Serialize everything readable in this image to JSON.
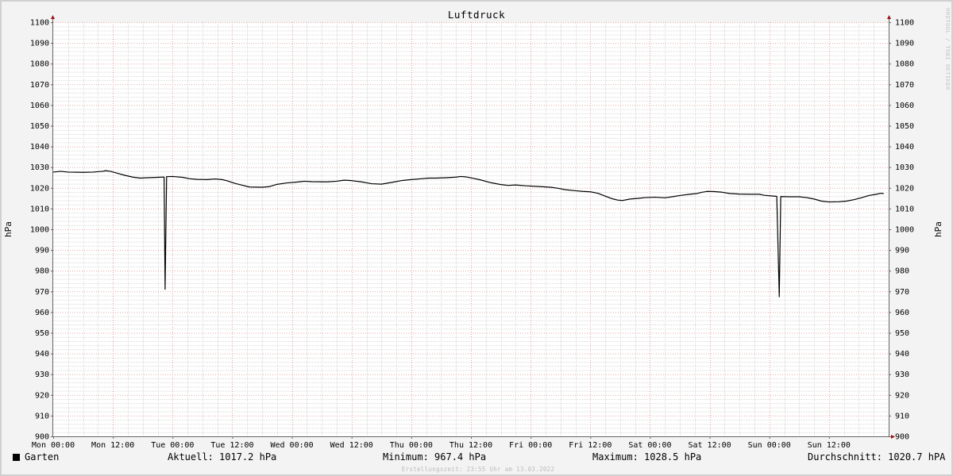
{
  "chart_data": {
    "type": "line",
    "title": "Luftdruck",
    "ylabel_left": "hPa",
    "ylabel_right": "hPa",
    "ylim": [
      900,
      1100
    ],
    "y_ticks": [
      900,
      910,
      920,
      930,
      940,
      950,
      960,
      970,
      980,
      990,
      1000,
      1010,
      1020,
      1030,
      1040,
      1050,
      1060,
      1070,
      1080,
      1090,
      1100
    ],
    "xlim_hours": [
      0,
      168
    ],
    "x_ticks": [
      {
        "hour": 0,
        "label": "Mon 00:00"
      },
      {
        "hour": 12,
        "label": "Mon 12:00"
      },
      {
        "hour": 24,
        "label": "Tue 00:00"
      },
      {
        "hour": 36,
        "label": "Tue 12:00"
      },
      {
        "hour": 48,
        "label": "Wed 00:00"
      },
      {
        "hour": 60,
        "label": "Wed 12:00"
      },
      {
        "hour": 72,
        "label": "Thu 00:00"
      },
      {
        "hour": 84,
        "label": "Thu 12:00"
      },
      {
        "hour": 96,
        "label": "Fri 00:00"
      },
      {
        "hour": 108,
        "label": "Fri 12:00"
      },
      {
        "hour": 120,
        "label": "Sat 00:00"
      },
      {
        "hour": 132,
        "label": "Sat 12:00"
      },
      {
        "hour": 144,
        "label": "Sun 00:00"
      },
      {
        "hour": 156,
        "label": "Sun 12:00"
      }
    ],
    "grid": true,
    "series": [
      {
        "name": "Garten",
        "color": "#000000",
        "points": [
          [
            0,
            1027.6
          ],
          [
            1.5,
            1028.0
          ],
          [
            3,
            1027.6
          ],
          [
            6,
            1027.5
          ],
          [
            8,
            1027.6
          ],
          [
            10,
            1028.0
          ],
          [
            10.5,
            1028.3
          ],
          [
            11.5,
            1028.0
          ],
          [
            13,
            1027.0
          ],
          [
            14.5,
            1026.0
          ],
          [
            16,
            1025.2
          ],
          [
            17.5,
            1024.7
          ],
          [
            19,
            1024.9
          ],
          [
            21,
            1025.1
          ],
          [
            22,
            1025.2
          ],
          [
            22.3,
            1025.2
          ],
          [
            22.5,
            971.0
          ],
          [
            22.8,
            1025.4
          ],
          [
            24,
            1025.5
          ],
          [
            26,
            1025.1
          ],
          [
            27.5,
            1024.4
          ],
          [
            29,
            1024.1
          ],
          [
            31,
            1024.0
          ],
          [
            32.5,
            1024.3
          ],
          [
            34,
            1024.0
          ],
          [
            35,
            1023.4
          ],
          [
            36.5,
            1022.2
          ],
          [
            38,
            1021.3
          ],
          [
            39.5,
            1020.4
          ],
          [
            42,
            1020.3
          ],
          [
            43.5,
            1020.6
          ],
          [
            45,
            1021.7
          ],
          [
            47,
            1022.4
          ],
          [
            49,
            1022.8
          ],
          [
            50.5,
            1023.2
          ],
          [
            52,
            1023.0
          ],
          [
            55,
            1022.9
          ],
          [
            57,
            1023.2
          ],
          [
            58.5,
            1023.7
          ],
          [
            60,
            1023.5
          ],
          [
            62,
            1022.9
          ],
          [
            64,
            1022.0
          ],
          [
            66,
            1021.8
          ],
          [
            68,
            1022.6
          ],
          [
            70,
            1023.5
          ],
          [
            72,
            1024.0
          ],
          [
            74,
            1024.4
          ],
          [
            75.5,
            1024.7
          ],
          [
            77,
            1024.7
          ],
          [
            79,
            1024.9
          ],
          [
            81,
            1025.2
          ],
          [
            82,
            1025.5
          ],
          [
            83,
            1025.3
          ],
          [
            84.5,
            1024.6
          ],
          [
            86,
            1023.8
          ],
          [
            88,
            1022.5
          ],
          [
            90,
            1021.6
          ],
          [
            91.5,
            1021.2
          ],
          [
            93,
            1021.4
          ],
          [
            95,
            1021.0
          ],
          [
            98,
            1020.6
          ],
          [
            100,
            1020.3
          ],
          [
            101.5,
            1019.8
          ],
          [
            103,
            1019.1
          ],
          [
            105,
            1018.6
          ],
          [
            106.5,
            1018.3
          ],
          [
            108,
            1018.1
          ],
          [
            109.5,
            1017.4
          ],
          [
            111,
            1016.0
          ],
          [
            112.5,
            1014.7
          ],
          [
            113.5,
            1014.1
          ],
          [
            114.5,
            1013.9
          ],
          [
            116,
            1014.6
          ],
          [
            117.5,
            1014.9
          ],
          [
            119,
            1015.3
          ],
          [
            121,
            1015.5
          ],
          [
            123,
            1015.2
          ],
          [
            124.5,
            1015.7
          ],
          [
            126,
            1016.3
          ],
          [
            128,
            1016.9
          ],
          [
            129.5,
            1017.3
          ],
          [
            130.5,
            1017.9
          ],
          [
            131.5,
            1018.3
          ],
          [
            133,
            1018.2
          ],
          [
            134.5,
            1017.9
          ],
          [
            136,
            1017.3
          ],
          [
            138,
            1017.0
          ],
          [
            140,
            1016.9
          ],
          [
            142,
            1016.9
          ],
          [
            143,
            1016.4
          ],
          [
            144.5,
            1016.1
          ],
          [
            145.5,
            1015.9
          ],
          [
            146,
            967.4
          ],
          [
            146.3,
            1015.8
          ],
          [
            148,
            1015.7
          ],
          [
            150,
            1015.7
          ],
          [
            151.5,
            1015.3
          ],
          [
            153,
            1014.6
          ],
          [
            154.5,
            1013.6
          ],
          [
            156,
            1013.2
          ],
          [
            158,
            1013.3
          ],
          [
            159.5,
            1013.6
          ],
          [
            161,
            1014.3
          ],
          [
            162.5,
            1015.2
          ],
          [
            164,
            1016.3
          ],
          [
            165.5,
            1016.9
          ],
          [
            166.5,
            1017.4
          ],
          [
            167,
            1017.2
          ]
        ]
      }
    ]
  },
  "legend": {
    "series_name": "Garten",
    "aktuell": "Aktuell: 1017.2 hPa",
    "minimum": "Minimum: 967.4 hPa",
    "maximum": "Maximum: 1028.5 hPa",
    "durchschnitt": "Durchschnitt: 1020.7 hPA"
  },
  "footer": "Erstellungszeit: 23:55 Uhr am 13.03.2022",
  "watermark": "RRDTOOL / TOBI OETIKER"
}
